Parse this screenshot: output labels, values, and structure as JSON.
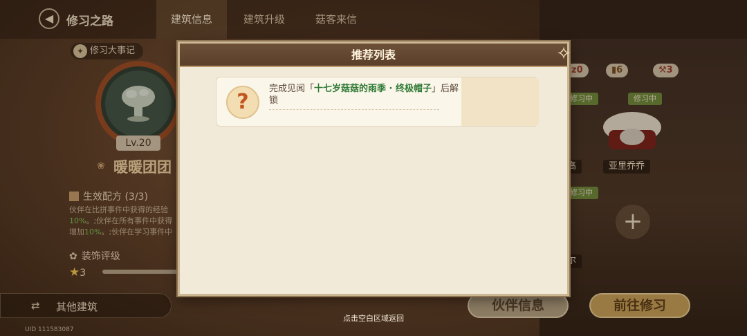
{
  "header": {
    "title": "修习之路",
    "back_icon": "arrow-left-icon",
    "tabs": [
      {
        "label": "建筑信息",
        "active": true
      },
      {
        "label": "建筑升级",
        "active": false
      },
      {
        "label": "菇客来信",
        "active": false
      }
    ]
  },
  "left_panel": {
    "chronicle_label": "修习大事记",
    "level": "Lv.20",
    "team_name": "暖暖团团",
    "recipe_label": "生效配方 (3/3)",
    "recipe_desc_lines": [
      {
        "text": "伙伴在比拼事件中获得的经验",
        "green": ""
      },
      {
        "green": "10%",
        "text": "。;伙伴在所有事件中获得"
      },
      {
        "text": "增加",
        "green": "10%",
        "tail": "。;伙伴在学习事件中"
      }
    ],
    "decoration_label": "装饰评级",
    "decoration_stars": "3",
    "other_buildings_label": "其他建筑",
    "uid": "UID 111583087"
  },
  "right_panel": {
    "stats": [
      {
        "icon": "zz-icon",
        "value": "0"
      },
      {
        "icon": "book-icon",
        "value": "6"
      },
      {
        "icon": "hammer-icon",
        "value": "3"
      }
    ],
    "status_badge": "修习中",
    "partners": [
      {
        "name": "高",
        "status": "修习中"
      },
      {
        "name": "亚里乔乔",
        "status": "修习中"
      },
      {
        "name": "尔",
        "status": "修习中"
      }
    ],
    "partner_info_button": "伙伴信息",
    "go_button": "前往修习"
  },
  "modal": {
    "title": "推荐列表",
    "card": {
      "prefix": "完成见闻「",
      "highlight": "十七岁菇菇的雨季 · 终极帽子",
      "suffix": "」后解锁"
    }
  },
  "hint": "点击空白区域返回",
  "colors": {
    "modal_bg": "#f2ead8",
    "highlight_green": "#2f7a34",
    "badge_green": "#6e8b3c",
    "go_button": "#c9a25b"
  }
}
